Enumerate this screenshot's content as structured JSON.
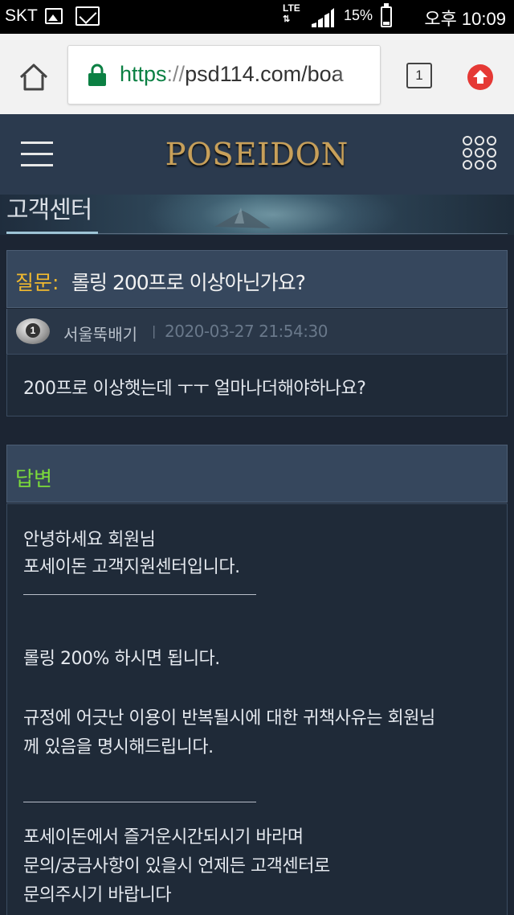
{
  "status_bar": {
    "carrier": "SKT",
    "network": "LTE",
    "battery_percent": "15%",
    "time": "오후 10:09",
    "icons": [
      "gallery-icon",
      "mail-icon",
      "signal-icon",
      "battery-icon"
    ]
  },
  "browser": {
    "url_scheme": "https",
    "url_separator": "://",
    "url_rest": "psd114.com/boa",
    "tab_count": "1"
  },
  "site": {
    "logo": "POSEIDON",
    "accent_color": "#c8a05a"
  },
  "banner": {
    "title": "고객센터"
  },
  "question": {
    "label": "질문:",
    "title": "롤링 200프로 이상아닌가요?",
    "author_level": "1",
    "author": "서울뚝배기",
    "separator": "|",
    "date": "2020-03-27 21:54:30",
    "body": "200프로 이상햇는데 ㅜㅜ 얼마나더해야하나요?"
  },
  "answer": {
    "label": "답변",
    "lines": [
      "안녕하세요 회원님",
      "포세이돈 고객지원센터입니다.",
      "롤링 200% 하시면 됩니다.",
      "규정에 어긋난 이용이 반복될시에 대한 귀책사유는 회원님",
      "께 있음을 명시해드립니다.",
      "포세이돈에서 즐거운시간되시기 바라며",
      "문의/궁금사항이 있을시 언제든 고객센터로",
      "문의주시기 바랍니다"
    ]
  }
}
